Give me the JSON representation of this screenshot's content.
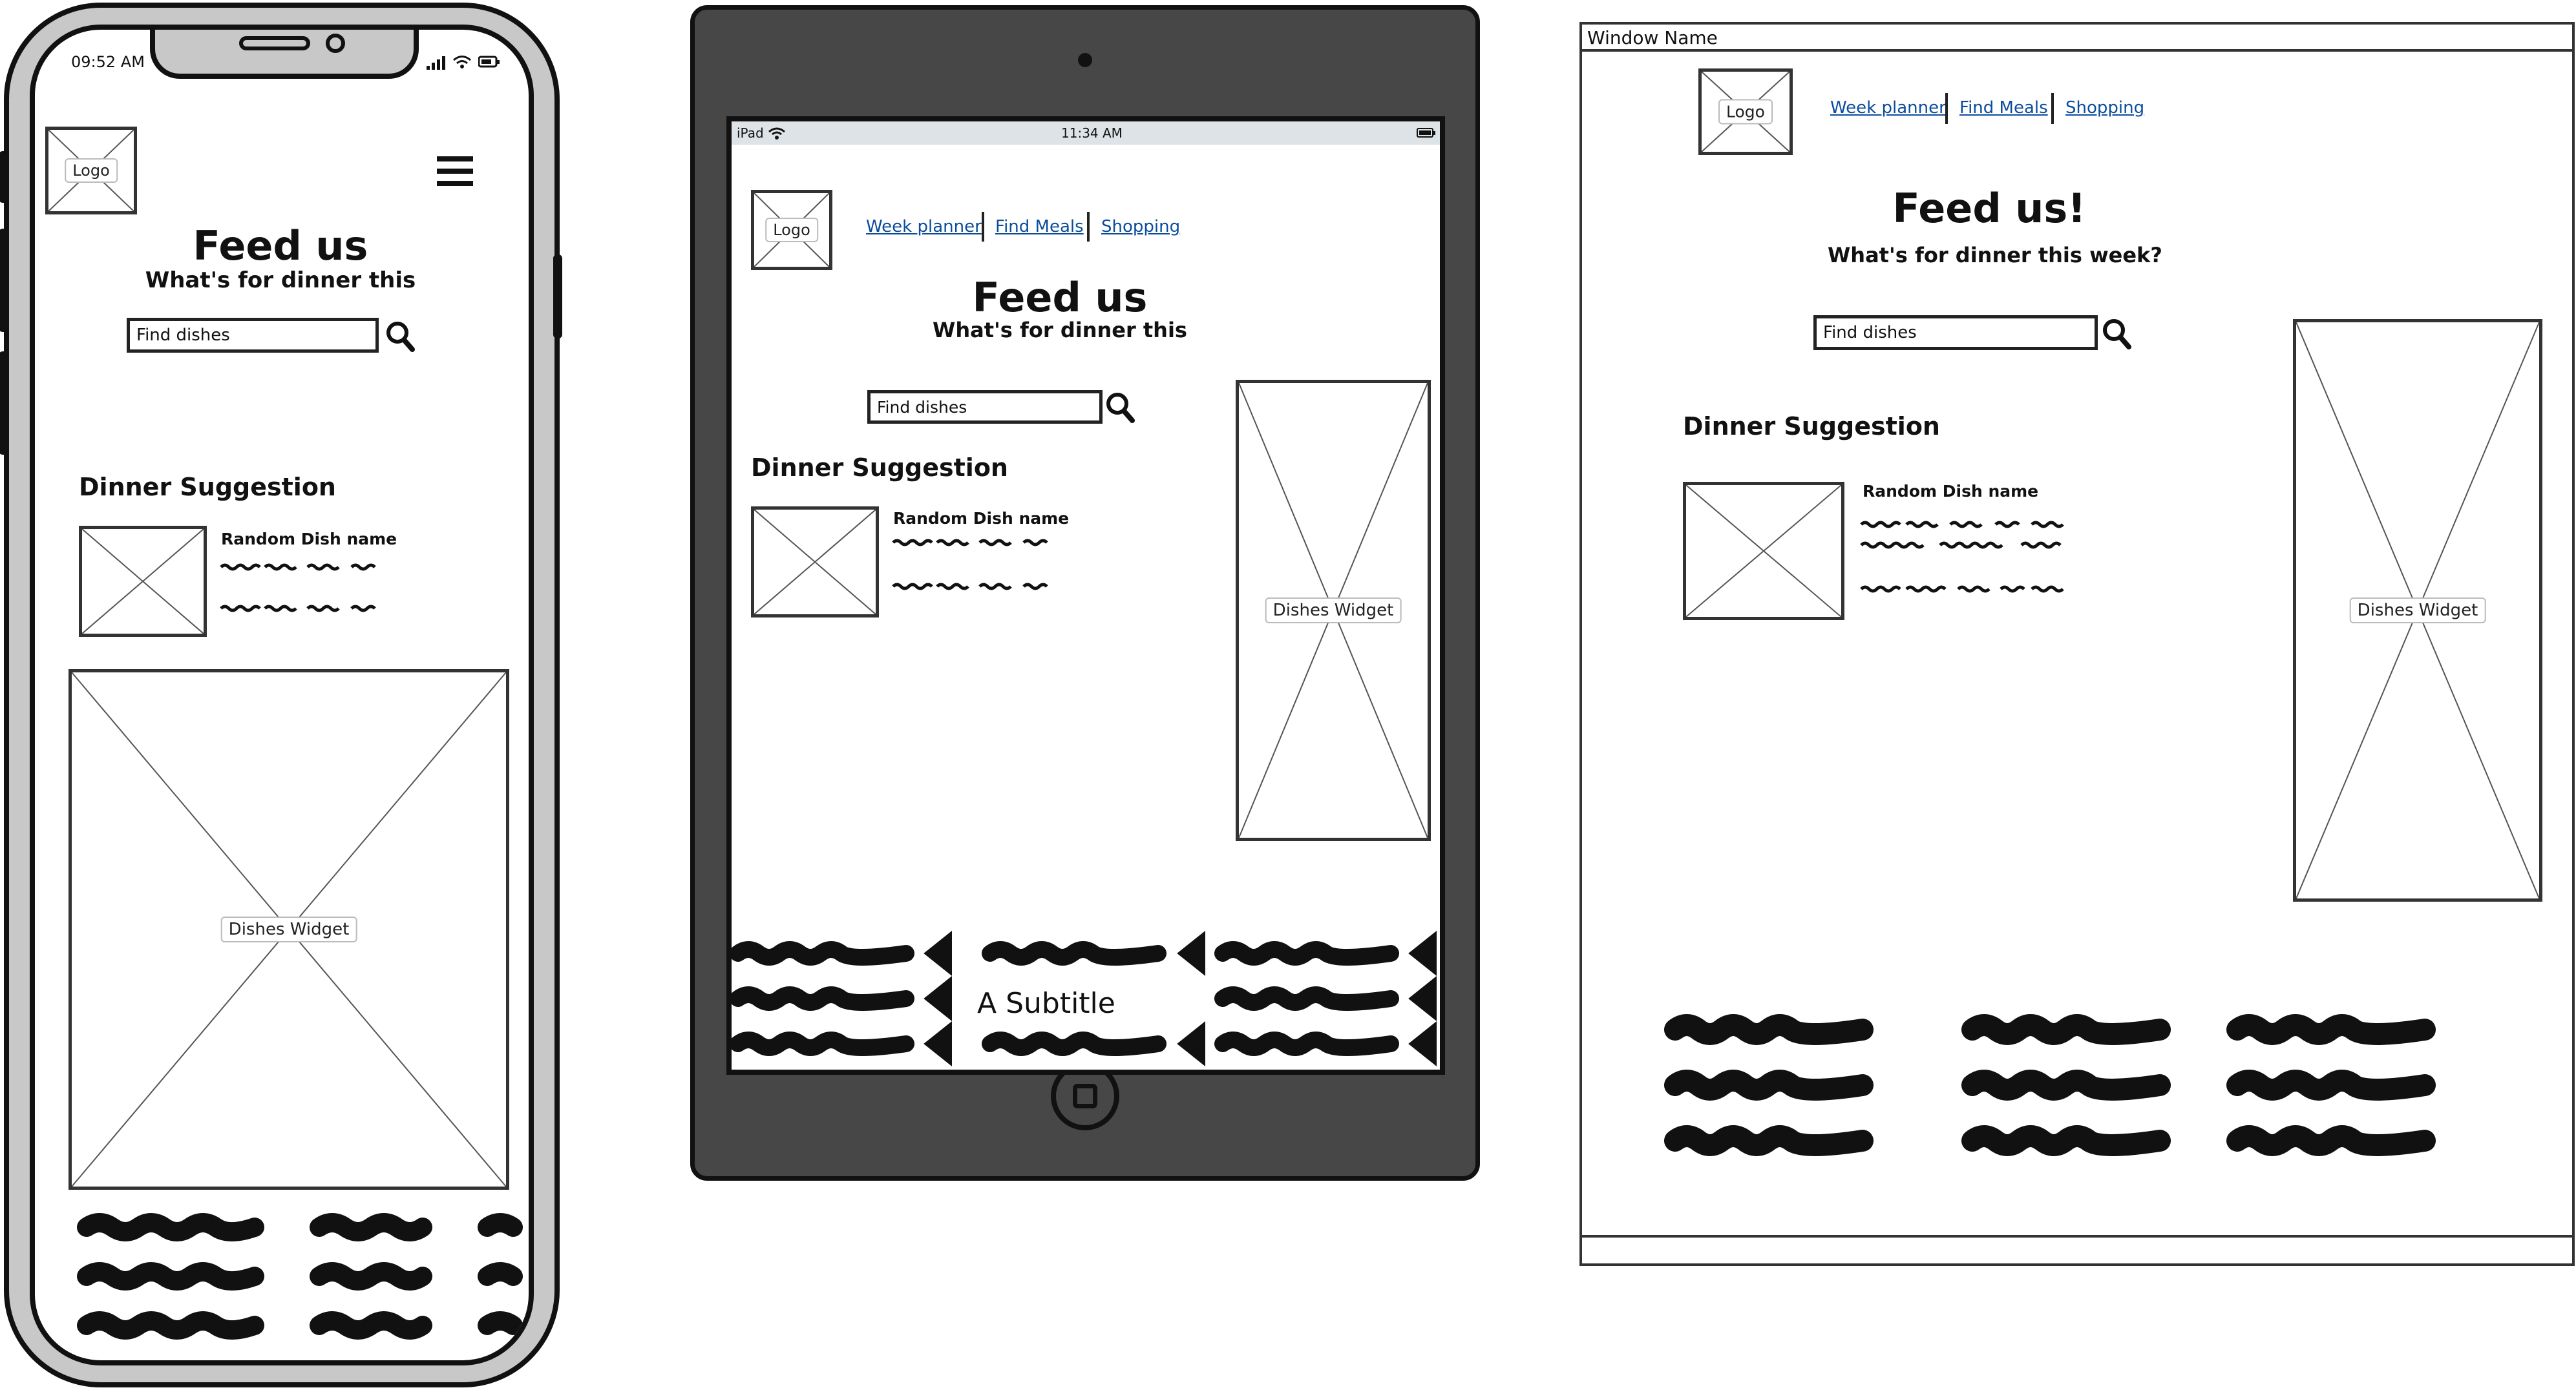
{
  "phone": {
    "status": {
      "time": "09:52 AM"
    },
    "logo": "Logo",
    "title": "Feed us",
    "subtitle": "What's for dinner this",
    "search_placeholder": "Find dishes",
    "section_title": "Dinner Suggestion",
    "dish_name": "Random Dish name",
    "widget_label": "Dishes Widget",
    "icons": {
      "menu": "hamburger-menu-icon",
      "search": "search-icon"
    }
  },
  "tablet": {
    "status": {
      "carrier": "iPad",
      "time": "11:34 AM"
    },
    "logo": "Logo",
    "nav": [
      "Week planner",
      "Find Meals",
      "Shopping"
    ],
    "title": "Feed us",
    "subtitle": "What's for dinner this",
    "search_placeholder": "Find dishes",
    "section_title": "Dinner Suggestion",
    "dish_name": "Random Dish name",
    "widget_label": "Dishes Widget",
    "footer_subtitle": "A Subtitle"
  },
  "desktop": {
    "window_name": "Window Name",
    "logo": "Logo",
    "nav": [
      "Week planner",
      "Find Meals",
      "Shopping"
    ],
    "title": "Feed us!",
    "subtitle": "What's for dinner this week?",
    "search_placeholder": "Find dishes",
    "section_title": "Dinner Suggestion",
    "dish_name": "Random Dish name",
    "widget_label": "Dishes Widget"
  },
  "colors": {
    "link": "#0b4d9c",
    "tablet_frame": "#474747",
    "phone_frame": "#c8c8c8"
  }
}
